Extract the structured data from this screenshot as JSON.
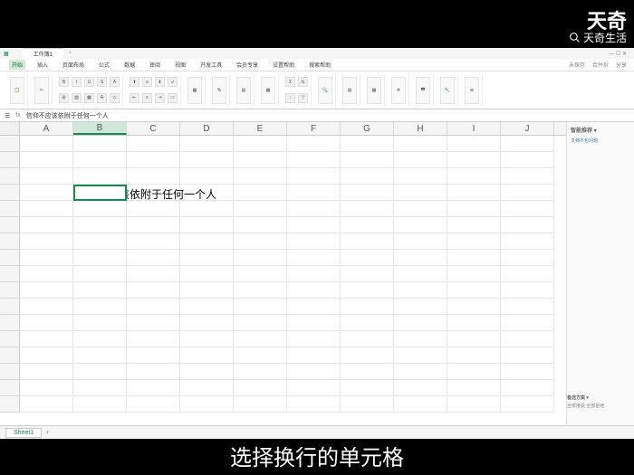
{
  "watermark": {
    "main": "天奇",
    "sub": "天奇生活"
  },
  "titlebar": {
    "filename": "工作簿1"
  },
  "menu": {
    "items": [
      "开始",
      "插入",
      "页面布局",
      "公式",
      "数据",
      "审阅",
      "视图",
      "开发工具",
      "会员专享",
      "设置帮助",
      "搜索帮助"
    ],
    "right": [
      "未保存",
      "合并拆",
      "分享"
    ]
  },
  "formula": {
    "fx": "fx",
    "content": "信仰不应该依附于任何一个人"
  },
  "columns": [
    "A",
    "B",
    "C",
    "D",
    "E",
    "F",
    "G",
    "H",
    "I",
    "J"
  ],
  "cell": {
    "text": "信仰不应该依附于任何一个人"
  },
  "panel": {
    "title": "智能推荐 ▾",
    "sub": "文档不包问题"
  },
  "panel2": {
    "a": "备选方案 ▾",
    "b": "",
    "c": "全部接受  全部拒绝"
  },
  "sheet": {
    "name": "Sheet1",
    "plus": "+"
  },
  "caption": "选择换行的单元格"
}
